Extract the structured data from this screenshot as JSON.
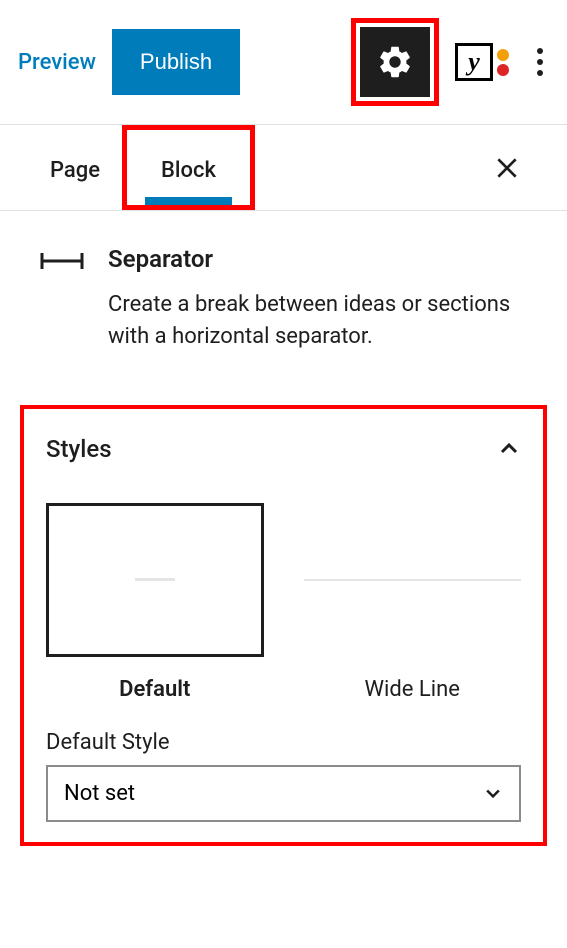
{
  "topbar": {
    "preview": "Preview",
    "publish": "Publish"
  },
  "tabs": {
    "page": "Page",
    "block": "Block"
  },
  "block": {
    "title": "Separator",
    "description": "Create a break between ideas or sections with a horizontal separator."
  },
  "styles": {
    "title": "Styles",
    "options": [
      {
        "label": "Default"
      },
      {
        "label": "Wide Line"
      }
    ],
    "default_label": "Default Style",
    "default_value": "Not set"
  }
}
